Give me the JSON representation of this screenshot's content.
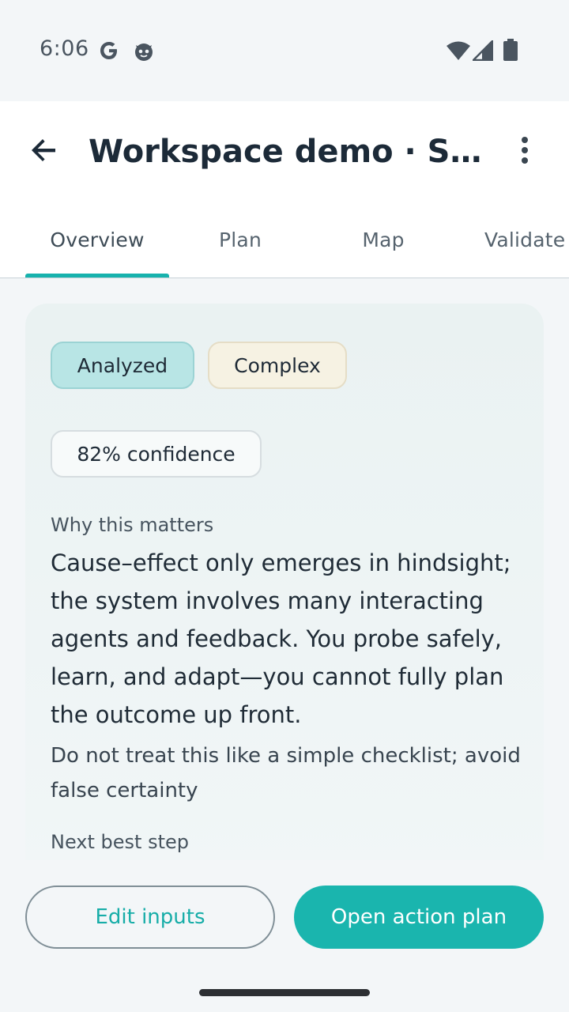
{
  "status_bar": {
    "time": "6:06",
    "icons": [
      "google-icon",
      "cat-face-icon",
      "wifi-icon",
      "cell-signal-icon",
      "battery-icon"
    ]
  },
  "app_bar": {
    "title": "Workspace demo · Situ…",
    "back_icon": "arrow-back-icon",
    "more_icon": "more-vert-icon"
  },
  "tabs": [
    {
      "label": "Overview",
      "active": true
    },
    {
      "label": "Plan",
      "active": false
    },
    {
      "label": "Map",
      "active": false
    },
    {
      "label": "Validate",
      "active": false
    }
  ],
  "card": {
    "chips": {
      "status": "Analyzed",
      "complexity": "Complex",
      "confidence": "82% confidence"
    },
    "why_label": "Why this matters",
    "reason": "Cause–effect only emerges in hindsight; the system involves many interacting agents and feedback. You probe safely, learn, and adapt—you cannot fully plan the outcome up front.",
    "caution": "Do not treat this like a simple checklist; avoid false certainty",
    "next_label": "Next best step"
  },
  "actions": {
    "edit": "Edit inputs",
    "open_plan": "Open action plan"
  },
  "colors": {
    "accent": "#17b2ad",
    "analyzed_chip": "#b8e5e5",
    "complex_chip": "#f6f2e3",
    "title": "#1c2a38"
  }
}
